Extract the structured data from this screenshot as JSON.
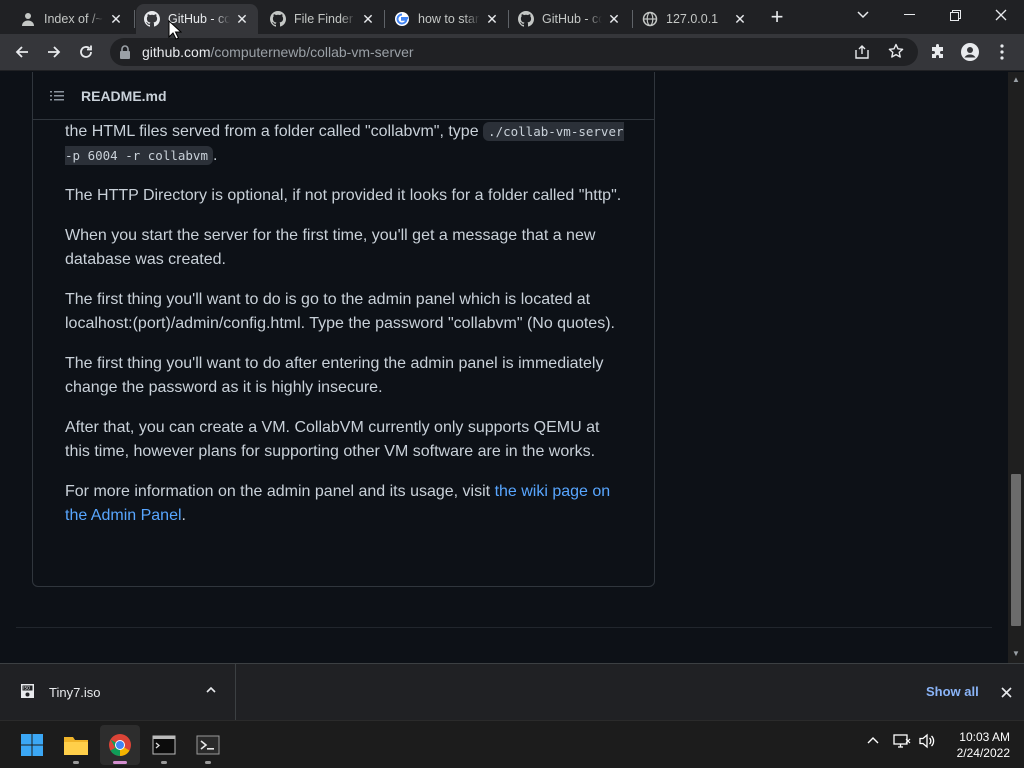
{
  "browser": {
    "tabs": [
      {
        "title": "Index of /~",
        "favicon": "folder-user-icon",
        "active": false
      },
      {
        "title": "GitHub - computernewb/collab-vm-server",
        "favicon": "github-icon",
        "active": true
      },
      {
        "title": "File Finder",
        "favicon": "github-icon",
        "active": false
      },
      {
        "title": "how to start",
        "favicon": "google-icon",
        "active": false
      },
      {
        "title": "GitHub - computernewb",
        "favicon": "github-icon",
        "active": false
      },
      {
        "title": "127.0.0.1",
        "favicon": "globe-icon",
        "active": false
      }
    ],
    "url_host": "github.com",
    "url_path": "/computernewb/collab-vm-server"
  },
  "readme": {
    "filename": "README.md",
    "p1_pre": "the HTML files served from a folder called \"collabvm\", type ",
    "p1_code": "./collab-vm-server -p 6004 -r collabvm",
    "p1_post": ".",
    "p2": "The HTTP Directory is optional, if not provided it looks for a folder called \"http\".",
    "p3": "When you start the server for the first time, you'll get a message that a new database was created.",
    "p4": "The first thing you'll want to do is go to the admin panel which is located at localhost:(port)/admin/config.html. Type the password \"collabvm\" (No quotes).",
    "p5": "The first thing you'll want to do after entering the admin panel is immediately change the password as it is highly insecure.",
    "p6": "After that, you can create a VM. CollabVM currently only supports QEMU at this time, however plans for supporting other VM software are in the works.",
    "p7_pre": "For more information on the admin panel and its usage, visit ",
    "p7_link": "the wiki page on the Admin Panel",
    "p7_post": "."
  },
  "downloads": {
    "item_name": "Tiny7.iso",
    "show_all": "Show all"
  },
  "taskbar": {
    "time": "10:03 AM",
    "date": "2/24/2022",
    "apps": [
      "windows-start-icon",
      "file-explorer-icon",
      "chrome-icon",
      "terminal-icon",
      "powershell-icon"
    ]
  },
  "colors": {
    "page_bg": "#0d1117",
    "text": "#c9d1d9",
    "link": "#58a6ff",
    "chrome_dark": "#202124",
    "chrome_toolbar": "#35363a"
  }
}
